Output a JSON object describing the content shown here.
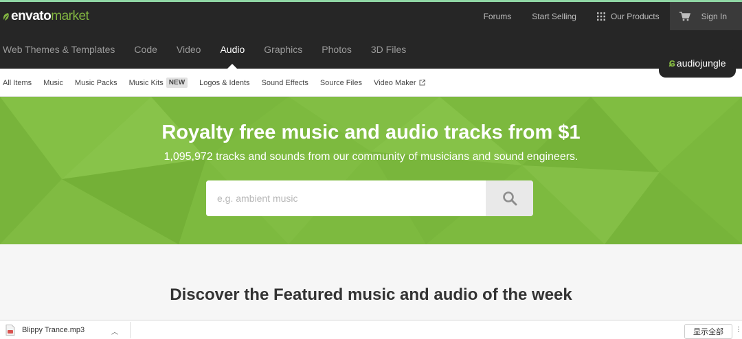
{
  "topbar": {
    "logo_brand": "envato",
    "logo_market": "market",
    "links": {
      "forums": "Forums",
      "start_selling": "Start Selling",
      "our_products": "Our Products",
      "sign_in": "Sign In"
    }
  },
  "categories": [
    "Web Themes & Templates",
    "Code",
    "Video",
    "Audio",
    "Graphics",
    "Photos",
    "3D Files"
  ],
  "active_category": "Audio",
  "site_badge": "audiojungle",
  "subnav": {
    "all_items": "All Items",
    "music": "Music",
    "music_packs": "Music Packs",
    "music_kits": "Music Kits",
    "new_badge": "NEW",
    "logos_idents": "Logos & Idents",
    "sound_effects": "Sound Effects",
    "source_files": "Source Files",
    "video_maker": "Video Maker"
  },
  "hero": {
    "title": "Royalty free music and audio tracks from $1",
    "subtitle": "1,095,972 tracks and sounds from our community of musicians and sound engineers.",
    "search_placeholder": "e.g. ambient music"
  },
  "featured_heading": "Discover the Featured music and audio of the week",
  "download_bar": {
    "file_name": "Blippy Trance.mp3",
    "show_all": "显示全部"
  },
  "colors": {
    "topbar_bg": "#262626",
    "hero_green": "#7dba3f",
    "accent_green": "#82b541"
  },
  "icons": [
    "leaf-icon",
    "grid-icon",
    "cart-icon",
    "audiojungle-icon",
    "external-link-icon",
    "search-icon",
    "audio-file-icon",
    "chevron-up-icon"
  ]
}
